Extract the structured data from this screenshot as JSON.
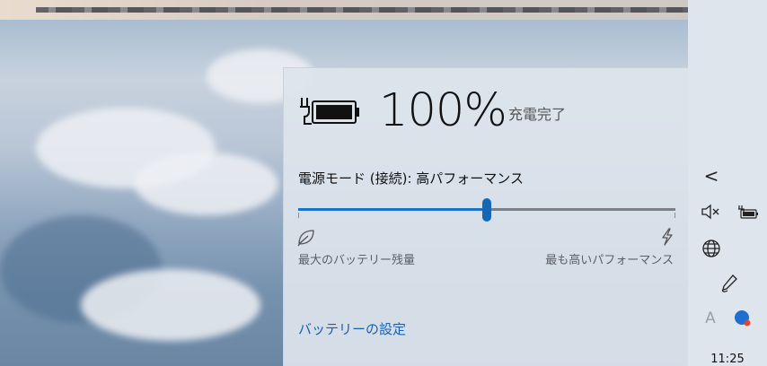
{
  "battery": {
    "percent": "100%",
    "status": "充電完了"
  },
  "power_mode": {
    "label": "電源モード (接続): 高パフォーマンス",
    "slider_value": 0.5,
    "min_label": "最大のバッテリー残量",
    "max_label": "最も高いパフォーマンス"
  },
  "settings_link": "バッテリーの設定",
  "taskbar": {
    "chevron": "<",
    "ime_glyph": "A",
    "clock": "11:25",
    "icons": [
      "chevron-left-icon",
      "speaker-muted-icon",
      "battery-plugged-icon",
      "globe-network-icon",
      "pen-icon",
      "ime-icon",
      "color-dot-icon"
    ]
  },
  "colors": {
    "accent": "#1a73c9",
    "link": "#1a5fb0",
    "panel_bg": "#dde4ec"
  }
}
